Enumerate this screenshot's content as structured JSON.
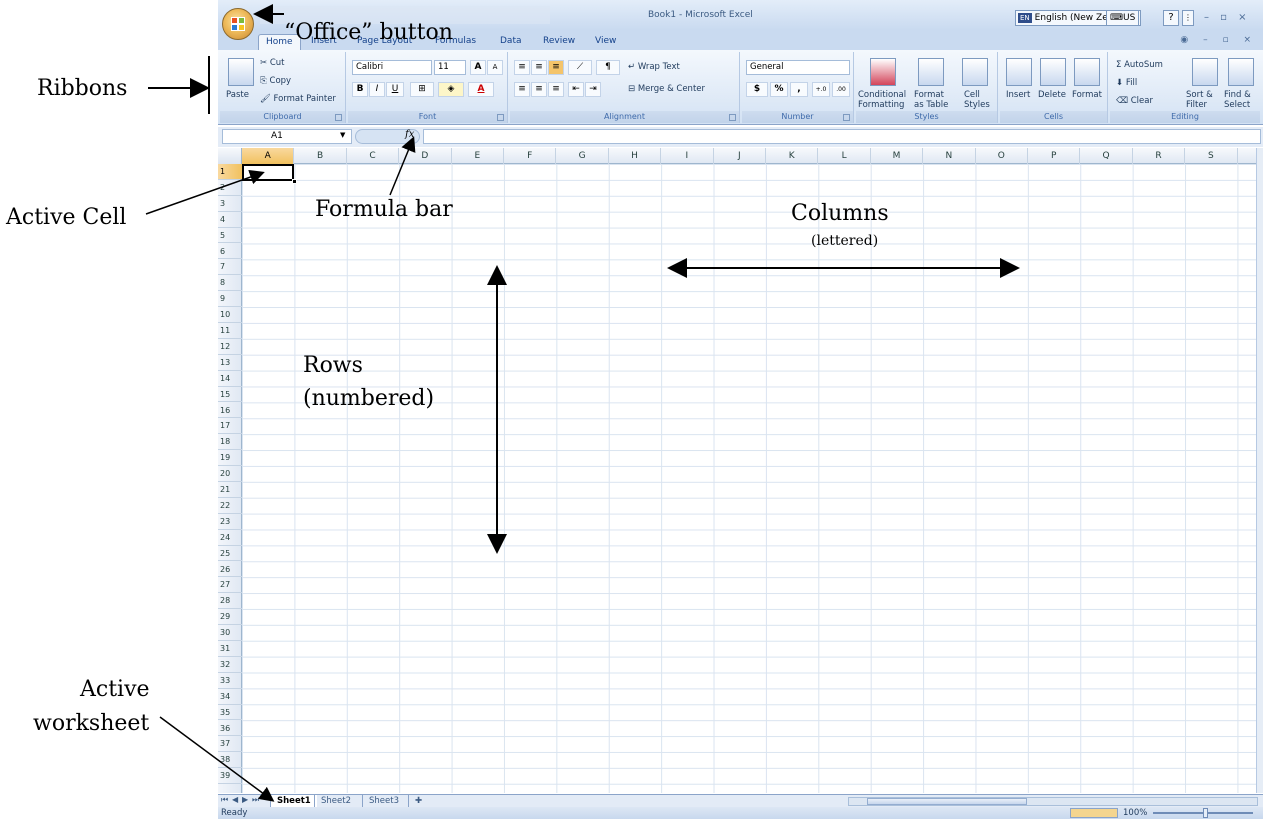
{
  "window": {
    "title": "Book1 - Microsoft Excel",
    "language": "English (New Zealand)",
    "language_code": "EN",
    "keyboard": "US",
    "help": "?",
    "options": "⋮",
    "controls": "– ▫ ×",
    "mini_controls": "◉ – ▫ ×"
  },
  "tabs": [
    "Home",
    "Insert",
    "Page Layout",
    "Formulas",
    "Data",
    "Review",
    "View"
  ],
  "ribbon": {
    "clipboard": {
      "label": "Clipboard",
      "paste": "Paste",
      "cut": "Cut",
      "copy": "Copy",
      "format_painter": "Format Painter"
    },
    "font": {
      "label": "Font",
      "font_name": "Calibri",
      "font_size": "11",
      "grow": "A",
      "shrink": "A",
      "bold": "B",
      "italic": "I",
      "underline": "U"
    },
    "alignment": {
      "label": "Alignment",
      "wrap_text": "Wrap Text",
      "merge_center": "Merge & Center"
    },
    "number": {
      "label": "Number",
      "format": "General",
      "currency": "$",
      "percent": "%",
      "comma": ",",
      "inc_decimal": "+.0 .00",
      "dec_decimal": ".00 →.0"
    },
    "styles": {
      "label": "Styles",
      "conditional": "Conditional",
      "conditional2": "Formatting",
      "format_as": "Format",
      "format_as2": "as Table",
      "cell": "Cell",
      "cell2": "Styles"
    },
    "cells": {
      "label": "Cells",
      "insert": "Insert",
      "delete": "Delete",
      "format": "Format"
    },
    "editing": {
      "label": "Editing",
      "autosum": "AutoSum",
      "fill": "Fill",
      "clear": "Clear",
      "sort": "Sort &",
      "sort2": "Filter",
      "find": "Find &",
      "find2": "Select"
    }
  },
  "formula_bar": {
    "name_box": "A1",
    "fx": "fx",
    "value": ""
  },
  "columns": [
    "A",
    "B",
    "C",
    "D",
    "E",
    "F",
    "G",
    "H",
    "I",
    "J",
    "K",
    "L",
    "M",
    "N",
    "O",
    "P",
    "Q",
    "R",
    "S"
  ],
  "rows": [
    "1",
    "2",
    "3",
    "4",
    "5",
    "6",
    "7",
    "8",
    "9",
    "10",
    "11",
    "12",
    "13",
    "14",
    "15",
    "16",
    "17",
    "18",
    "19",
    "20",
    "21",
    "22",
    "23",
    "24",
    "25",
    "26",
    "27",
    "28",
    "29",
    "30",
    "31",
    "32",
    "33",
    "34",
    "35",
    "36",
    "37",
    "38",
    "39"
  ],
  "active_cell": "A1",
  "sheets": [
    "Sheet1",
    "Sheet2",
    "Sheet3"
  ],
  "active_sheet": "Sheet1",
  "status": {
    "text": "Ready",
    "zoom": "100%"
  },
  "annotations": {
    "office_button": "“Office” button",
    "ribbons": "Ribbons",
    "active_cell": "Active Cell",
    "formula_bar": "Formula bar",
    "columns": "Columns",
    "columns_sub": "(lettered)",
    "rows": "Rows",
    "rows_sub": "(numbered)",
    "active_worksheet_1": "Active",
    "active_worksheet_2": "worksheet"
  }
}
